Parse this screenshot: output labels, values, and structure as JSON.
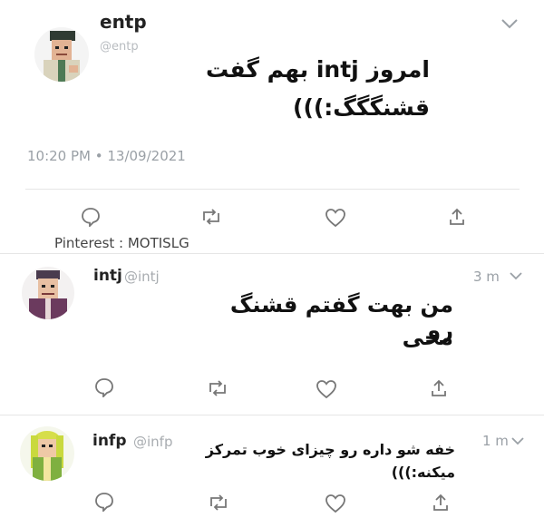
{
  "tweet1": {
    "display_name": "entp",
    "handle": "@entp",
    "text_line1": "امروز intj بهم گفت",
    "text_line2": "قشنگگگ:)))",
    "timestamp": "10:20 PM • 13/09/2021"
  },
  "watermark": "Pinterest : MOTISLG",
  "tweet2": {
    "display_name": "intj",
    "handle": "@intj",
    "time": "3 m",
    "text_line1": "من بهت گفتم قشنگ رو",
    "text_line2": "مخی"
  },
  "tweet3": {
    "display_name": "infp",
    "handle": "@infp",
    "time": "1 m",
    "text_line1": "خفه شو داره رو چیزای خوب تمرکز",
    "text_line2": "میکنه:)))"
  },
  "icons": [
    "reply-icon",
    "retweet-icon",
    "like-icon",
    "share-icon",
    "chevron-down-icon"
  ],
  "colors": {
    "muted": "#9aa0a6",
    "text": "#111111",
    "divider": "#e6e6e6"
  }
}
